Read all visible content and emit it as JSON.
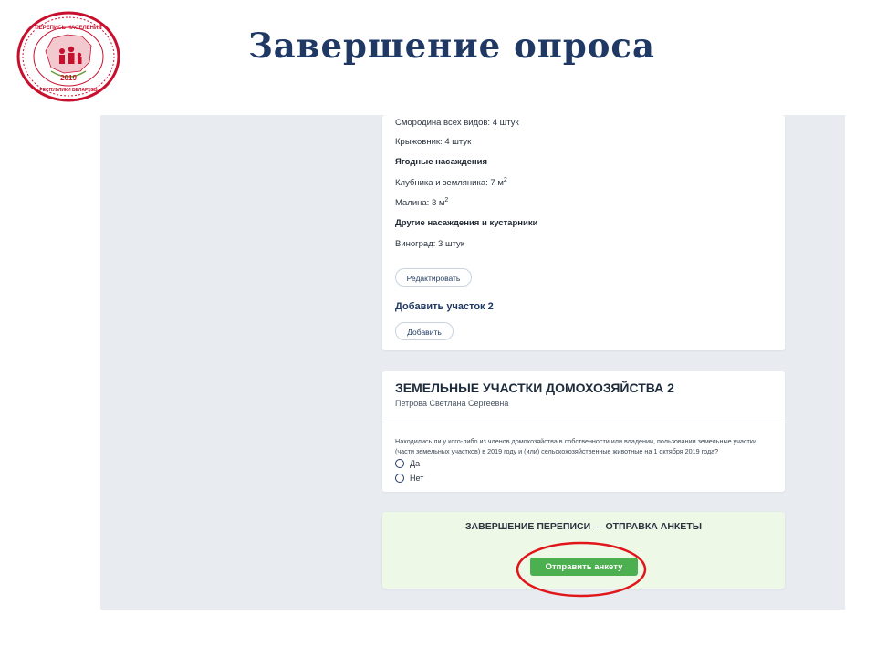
{
  "slide": {
    "title": "Завершение опроса",
    "logo": {
      "text_top": "ПЕРЕПИСЬ НАСЕЛЕНИЯ",
      "year": "2019",
      "text_bottom": "РЕСПУБЛИКИ БЕЛАРУСЬ"
    }
  },
  "plot_card": {
    "rows": [
      {
        "text": "Смородина всех видов: 4 штук"
      },
      {
        "text": "Крыжовник: 4 штук"
      },
      {
        "text": "Ягодные насаждения"
      },
      {
        "text": "Клубника и земляника: 7 м",
        "sup": "2"
      },
      {
        "text": "Малина: 3 м",
        "sup": "2"
      },
      {
        "text": "Другие насаждения и кустарники"
      },
      {
        "text": "Виноград: 3 штук"
      }
    ],
    "edit_label": "Редактировать",
    "add_plot_title": "Добавить участок 2",
    "add_label": "Добавить"
  },
  "household_card": {
    "title": "ЗЕМЕЛЬНЫЕ УЧАСТКИ ДОМОХОЗЯЙСТВА 2",
    "person": "Петрова Светлана Сергеевна",
    "question": "Находились ли у кого-либо из членов домохозяйства в собственности или владении, пользовании земельные участки (части земельных участков) в 2019 году и (или) сельскохозяйственные животные на 1 октября 2019 года?",
    "options": [
      "Да",
      "Нет"
    ]
  },
  "finish_card": {
    "title": "ЗАВЕРШЕНИЕ ПЕРЕПИСИ — ОТПРАВКА АНКЕТЫ",
    "send_label": "Отправить анкету"
  },
  "colors": {
    "title": "#1f3864",
    "send_button": "#4caf50",
    "highlight": "#e0161b",
    "logo_red": "#c8102e",
    "background": "#e8ecf1"
  }
}
